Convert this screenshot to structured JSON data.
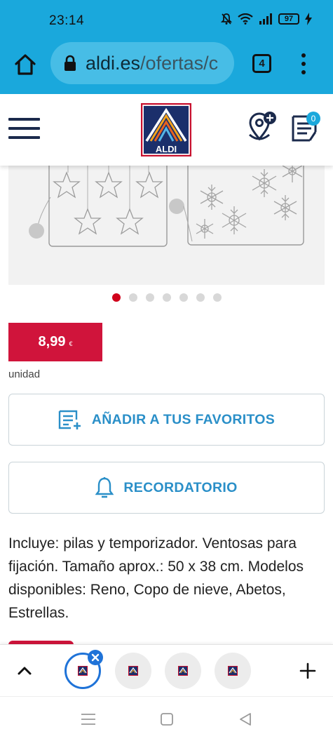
{
  "status_bar": {
    "time": "23:14",
    "battery": "97",
    "icons": [
      "mute-icon",
      "wifi-icon",
      "signal-icon",
      "battery-icon",
      "charging-icon"
    ]
  },
  "browser": {
    "url_domain": "aldi.es",
    "url_path": "/ofertas/c",
    "tab_count": "4",
    "accent_color": "#1aa8dc"
  },
  "header": {
    "logo_text": "ALDI",
    "list_badge": "0"
  },
  "product": {
    "image_alt_icons": [
      "stars-light-frame",
      "snowflakes-light-frame"
    ],
    "carousel_total": 7,
    "carousel_active": 1,
    "price": "8,99",
    "currency": "€",
    "unit": "unidad",
    "price_color": "#d0143b"
  },
  "actions": {
    "favorites_label": "AÑADIR A TUS FAVORITOS",
    "reminder_label": "RECORDATORIO",
    "action_color": "#2a8fc8"
  },
  "description": "Incluye: pilas y temporizador. Ventosas para fijación. Tamaño aprox.: 50 x 38 cm. Modelos disponibles: Reno, Copo de nieve, Abetos, Estrellas.",
  "tab_switcher": {
    "tab_count": 4
  }
}
